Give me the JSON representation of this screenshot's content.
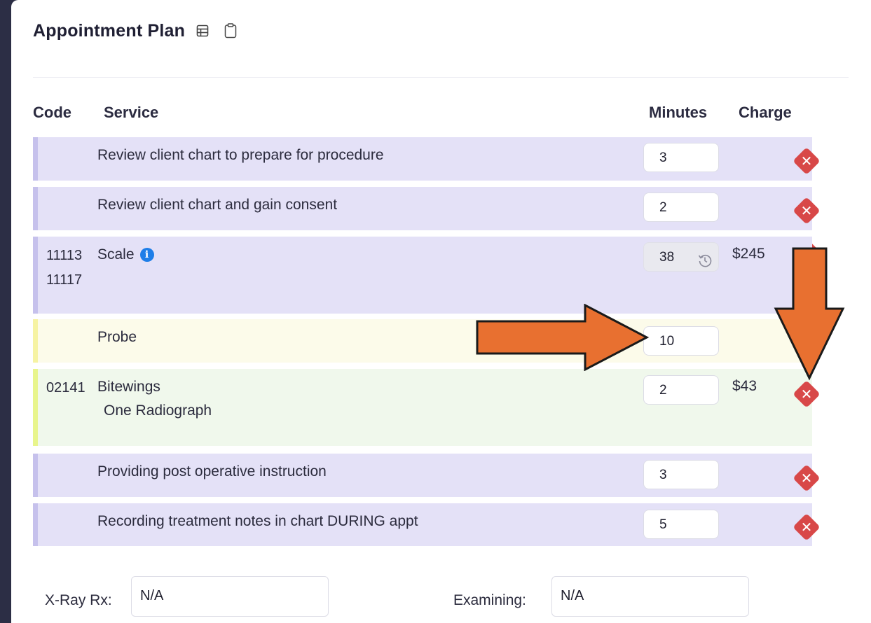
{
  "title": "Appointment Plan",
  "icons": {
    "table": "table-icon",
    "clipboard": "clipboard-icon",
    "history": "history-icon",
    "info": "info-icon",
    "delete": "delete-icon"
  },
  "headers": {
    "code": "Code",
    "service": "Service",
    "minutes": "Minutes",
    "charge": "Charge"
  },
  "rows": [
    {
      "service": "Review client chart to prepare for procedure",
      "minutes": "3",
      "color": "purple"
    },
    {
      "service": "Review client chart and gain consent",
      "minutes": "2",
      "color": "purple"
    },
    {
      "codes": [
        "11113",
        "11117"
      ],
      "service": "Scale",
      "minutes": "38",
      "charge": "$245",
      "color": "purple"
    },
    {
      "service": "Probe",
      "minutes": "10",
      "color": "yellow"
    },
    {
      "codes": [
        "02141"
      ],
      "service": "Bitewings",
      "sub": "One Radiograph",
      "minutes": "2",
      "charge": "$43",
      "color": "green"
    },
    {
      "service": "Providing post operative instruction",
      "minutes": "3",
      "color": "purple"
    },
    {
      "service": "Recording treatment notes in chart DURING appt",
      "minutes": "5",
      "color": "purple"
    }
  ],
  "fields": {
    "xray": {
      "label": "X-Ray Rx:",
      "value": "N/A"
    },
    "examining": {
      "label": "Examining:",
      "value": "N/A"
    }
  },
  "colors": {
    "purple": "#e4e1f7",
    "yellow": "#fcfbea",
    "green": "#f0f8ec",
    "delete": "#d84848",
    "arrow": "#e87030",
    "info": "#1e7ee8"
  }
}
